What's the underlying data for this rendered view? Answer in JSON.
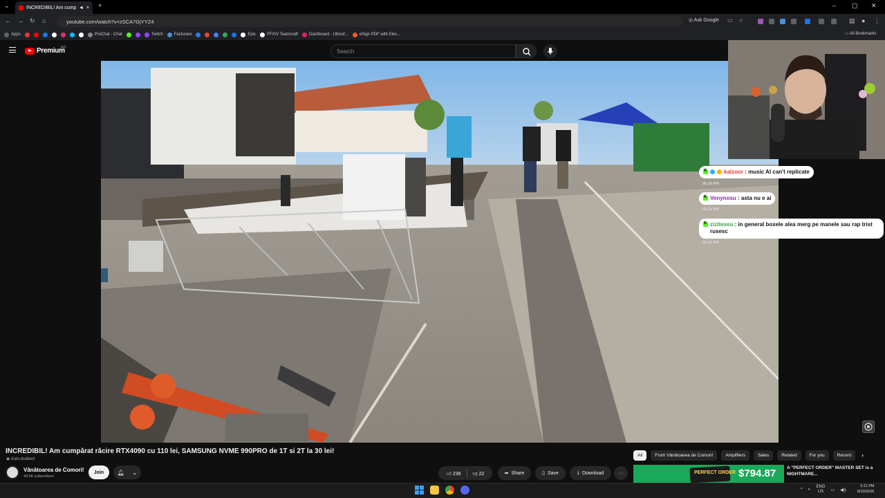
{
  "browser": {
    "tab_title": "INCREDIBIL! Am cumpărat ră",
    "tab_close": "×",
    "new_tab": "+",
    "url": "youtube.com/watch?v=zSCA7GjYYZ4",
    "ask_google": "Ask Google",
    "all_bookmarks": "All Bookmarks",
    "bookmarks": [
      {
        "label": "Apps",
        "color": "#5f6368"
      },
      {
        "label": "",
        "color": "#e53935"
      },
      {
        "label": "",
        "color": "#ff0000"
      },
      {
        "label": "",
        "color": "#1877f2"
      },
      {
        "label": "",
        "color": "#ffffff"
      },
      {
        "label": "",
        "color": "#e1306c"
      },
      {
        "label": "",
        "color": "#00c4ff"
      },
      {
        "label": "",
        "color": "#ffffff"
      },
      {
        "label": "ProChat - Chat",
        "color": "#888888"
      },
      {
        "label": "",
        "color": "#53fc18"
      },
      {
        "label": "",
        "color": "#9146ff"
      },
      {
        "label": "Twitch",
        "color": "#9146ff"
      },
      {
        "label": "Facturare",
        "color": "#4a90d9"
      },
      {
        "label": "",
        "color": "#2b7de9"
      },
      {
        "label": "",
        "color": "#ea4335"
      },
      {
        "label": "",
        "color": "#4285f4"
      },
      {
        "label": "",
        "color": "#34a853"
      },
      {
        "label": "",
        "color": "#1a73e8"
      },
      {
        "label": "Epic",
        "color": "#ffffff"
      },
      {
        "label": "FFXIV Teamcraft",
        "color": "#ffffff"
      },
      {
        "label": "Dashboard - Ubisof...",
        "color": "#e91e63"
      },
      {
        "label": "eSign PDF with Elec...",
        "color": "#ff5722"
      }
    ]
  },
  "youtube": {
    "logo_text": "Premium",
    "region": "RO",
    "search_placeholder": "Search"
  },
  "chat": [
    {
      "user": "kalzoor",
      "user_color": "#e53935",
      "text": "music AI can't replicate",
      "time": "05:10 PM"
    },
    {
      "user": "Venynosu",
      "user_color": "#8e24aa",
      "text": "asta nu e ai",
      "time": "05:11 PM"
    },
    {
      "user": "ziziteseu",
      "user_color": "#43a047",
      "text": "in general boxele alea merg pe manele sau rap trist rusesc",
      "time": "05:11 PM"
    }
  ],
  "video": {
    "title": "INCREDIBIL! Am cumpărat răcire RTX4090 cu 110 lei, SAMSUNG NVME 990PRO de 1T si 2T la 30 lei!",
    "dubbed": "Auto-dubbed",
    "channel": "Vânătoarea de Comori!",
    "subscribers": "44.6K subscribers",
    "join_label": "Join",
    "likes": "238",
    "dislikes": "22",
    "share_label": "Share",
    "save_label": "Save",
    "download_label": "Download",
    "more_label": "···"
  },
  "chips": [
    "All",
    "From Vânătoarea de Comori!",
    "Amplifiers",
    "Sales",
    "Related",
    "For you",
    "Recent"
  ],
  "recommendation": {
    "thumb_text": "PERFECT ORDER",
    "thumb_price": "$794.87",
    "title": "A \"PERFECT ORDER\" MASTER SET is a NIGHTMARE..."
  },
  "taskbar": {
    "lang_top": "ENG",
    "lang_bottom": "US",
    "time": "5:11 PM",
    "date": "8/23/2026"
  },
  "colors": {
    "yt_red": "#ff0000",
    "kick_green": "#53fc18",
    "bg": "#0f0f0f"
  }
}
